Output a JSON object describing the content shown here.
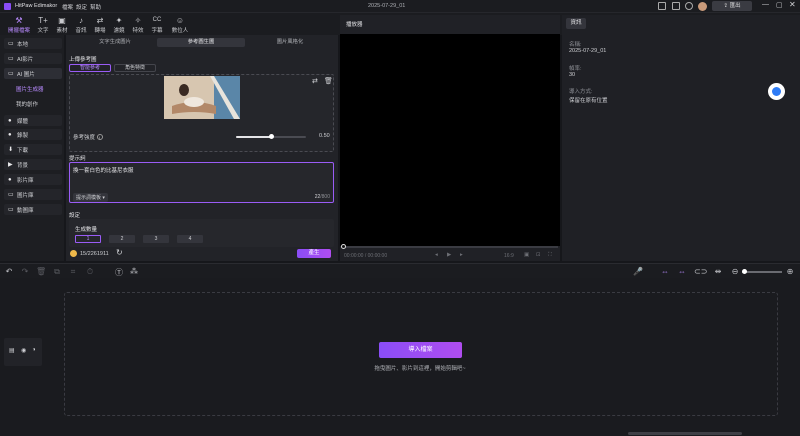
{
  "app": {
    "title": "HitPaw Edimakor",
    "menu": [
      "檔案",
      "設定",
      "幫助"
    ],
    "project_name": "2025-07-29_01",
    "export_label": "匯出"
  },
  "toolbar": {
    "items": [
      {
        "label": "開擺檔案",
        "icon": "⚒"
      },
      {
        "label": "文字",
        "icon": "T+"
      },
      {
        "label": "素材",
        "icon": "▣"
      },
      {
        "label": "音訊",
        "icon": "♪"
      },
      {
        "label": "轉場",
        "icon": "⇄"
      },
      {
        "label": "濾鏡",
        "icon": "✦"
      },
      {
        "label": "特效",
        "icon": "✧"
      },
      {
        "label": "字幕",
        "icon": "CC"
      },
      {
        "label": "數位人",
        "icon": "☺"
      }
    ]
  },
  "sidebar": {
    "items": [
      {
        "label": "本地",
        "icon": "▭"
      },
      {
        "label": "AI影片",
        "icon": "▭"
      },
      {
        "label": "AI 圖片",
        "icon": "▭"
      },
      {
        "label": "圖片生成器",
        "icon": ""
      },
      {
        "label": "我的創作",
        "icon": ""
      },
      {
        "label": "媒體",
        "icon": "●"
      },
      {
        "label": "錄製",
        "icon": "●"
      },
      {
        "label": "下載",
        "icon": "⬇"
      },
      {
        "label": "背景",
        "icon": "▶"
      },
      {
        "label": "影片庫",
        "icon": "●"
      },
      {
        "label": "圖片庫",
        "icon": "▭"
      },
      {
        "label": "動圖庫",
        "icon": "▭"
      }
    ]
  },
  "panel": {
    "tabs": [
      "文字生成圖片",
      "參考圖生圖",
      "圖片風格化"
    ],
    "upload_label": "上傳參考圖",
    "ref_modes": [
      "智能參考",
      "角色特徵"
    ],
    "strength_label": "參考強度",
    "strength_value": "0.50",
    "strength": 0.5,
    "prompt_label": "提示詞",
    "prompt_text": "換一套白色的比基尼衣服",
    "prompt_template": "提示詞模板",
    "prompt_count": "22",
    "prompt_max": "/800",
    "settings_label": "設定",
    "gen_count_label": "生成數量",
    "counts": [
      "1",
      "2",
      "3",
      "4"
    ],
    "credits": "15/2261911",
    "generate_label": "產生"
  },
  "preview": {
    "title": "播放器",
    "time": "00:00:00 / 00:00:00",
    "ratio": "16:9"
  },
  "info": {
    "tab": "資訊",
    "name_label": "名稱:",
    "name_value": "2025-07-29_01",
    "fps_label": "幀率:",
    "fps_value": "30",
    "import_label": "導入方式:",
    "import_value": "保留在原有位置"
  },
  "timeline": {
    "import_button": "導入檔案",
    "hint": "拖曳圖片、影片到這裡，開始剪輯吧~"
  }
}
